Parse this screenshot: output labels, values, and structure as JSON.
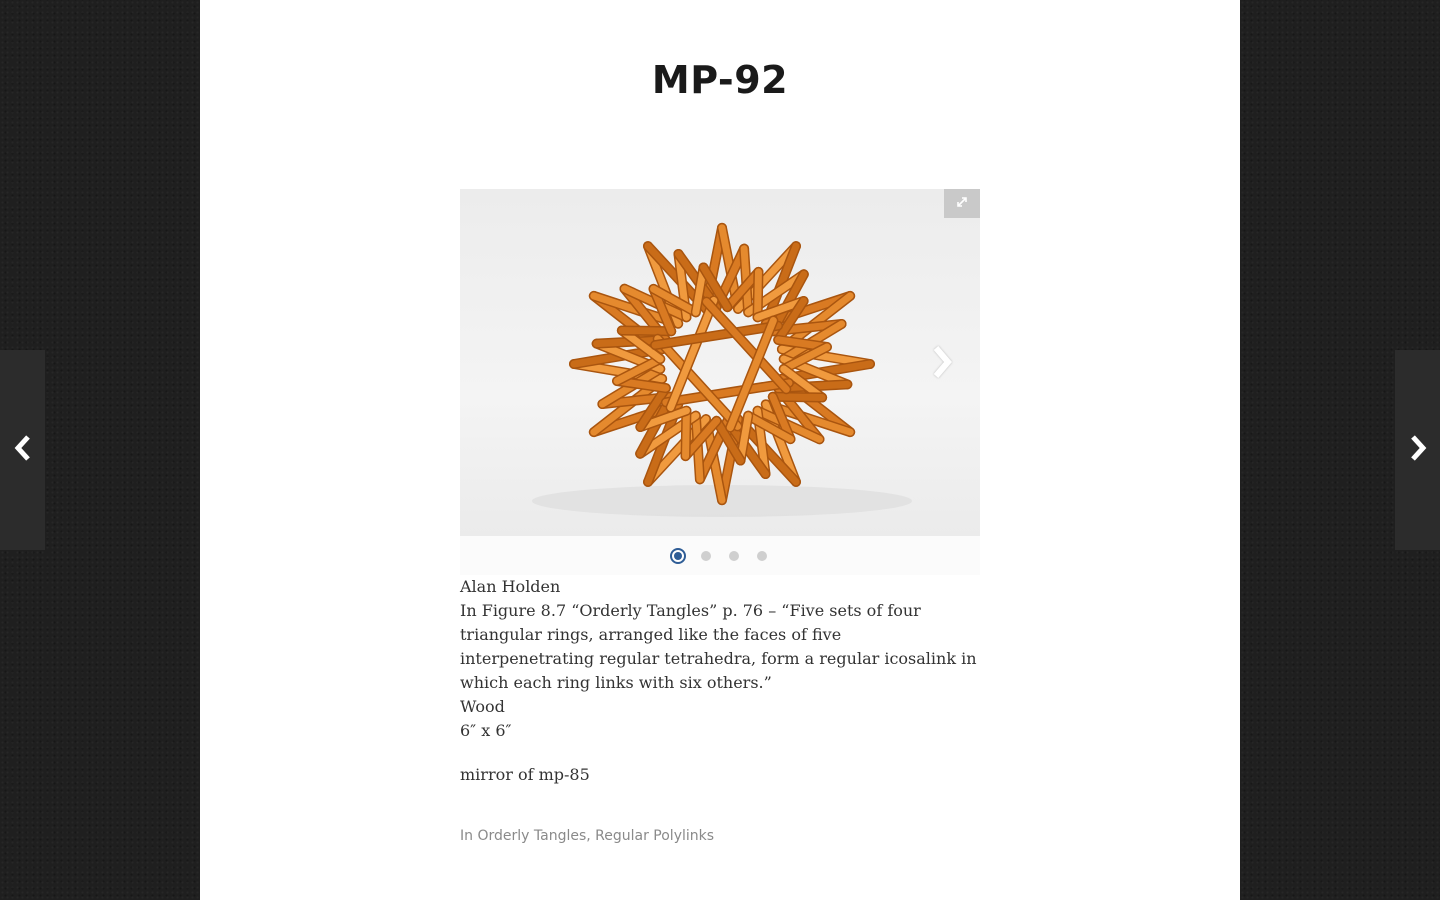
{
  "post": {
    "title": "MP-92"
  },
  "gallery": {
    "slide_count": 4,
    "active_index": 0,
    "icons": {
      "fullscreen": "expand-icon",
      "next": "chevron-right-icon"
    }
  },
  "details": {
    "artist": "Alan Holden",
    "description": "In Figure 8.7 “Orderly Tangles” p. 76 – “Five sets of four triangular rings, arranged like the faces of five interpenetrating regular tetrahedra, form a regular icosalink in which each ring links with six others.”",
    "material": "Wood",
    "dimensions": "6″ x 6″",
    "note": "mirror of mp-85"
  },
  "categories": {
    "prefix": "In",
    "items": [
      "Orderly Tangles",
      "Regular Polylinks"
    ],
    "separator": ","
  },
  "navigation": {
    "prev_icon": "chevron-left-icon",
    "next_icon": "chevron-right-icon"
  },
  "colors": {
    "page_bg": "#ffffff",
    "backdrop": "#1f1f1f",
    "side_nav": "#2c2c2c",
    "active_dot": "#2f5d96",
    "wood": "#e58a2e"
  }
}
